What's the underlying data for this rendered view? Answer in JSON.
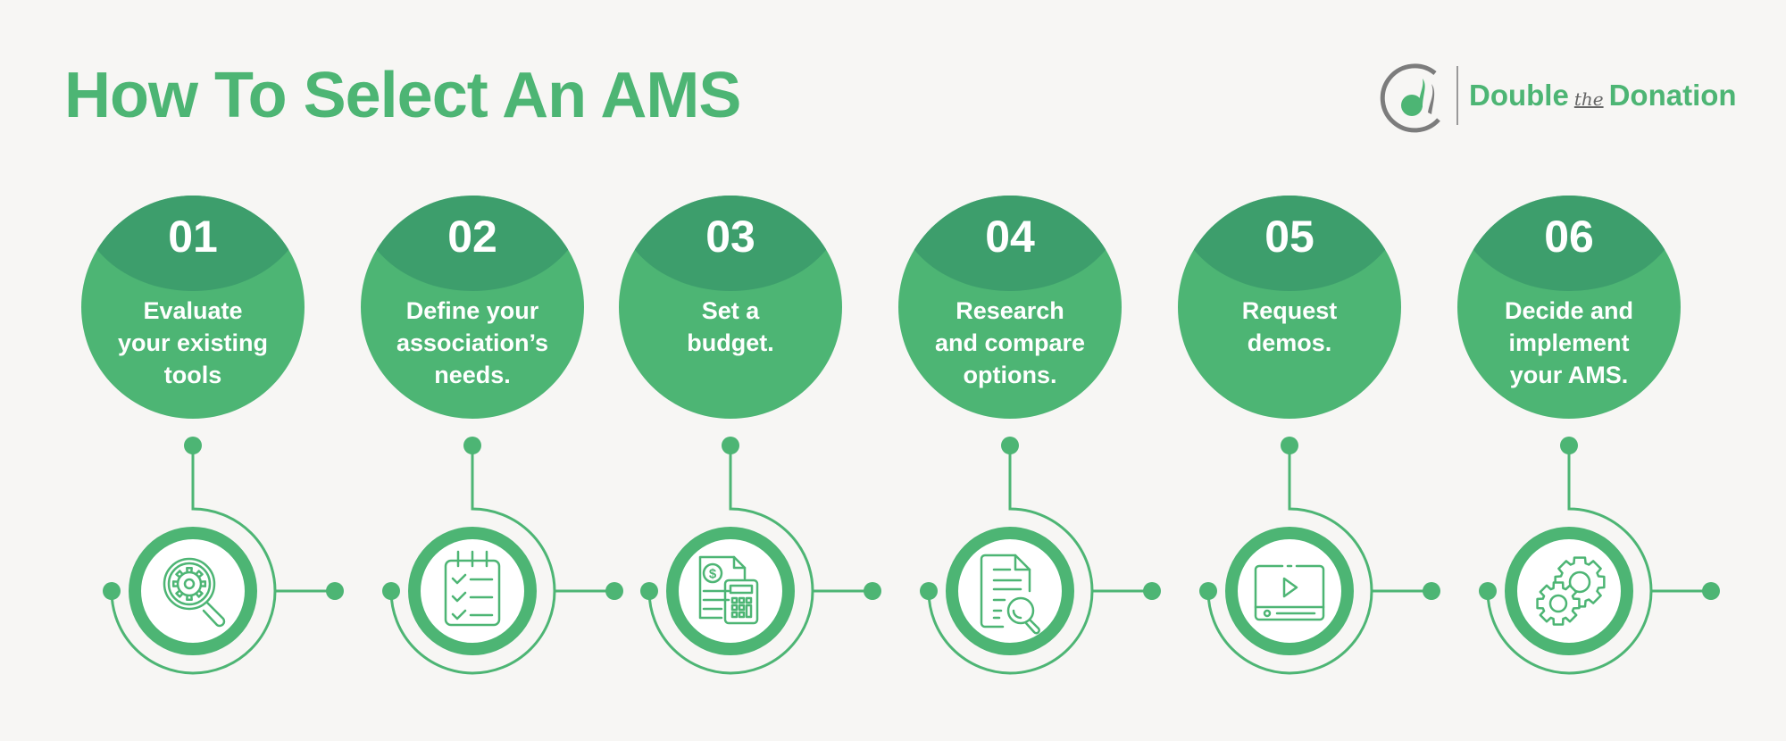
{
  "title": "How To Select An AMS",
  "logo": {
    "word1": "Double",
    "the": "the",
    "word2": "Donation"
  },
  "colors": {
    "primary": "#4db574",
    "dark": "#3d9e6c",
    "background": "#f7f6f4",
    "logo_gray": "#7c7c7c"
  },
  "steps": [
    {
      "number": "01",
      "lines": [
        "Evaluate",
        "your existing",
        "tools"
      ],
      "icon": "magnifier-gear-icon"
    },
    {
      "number": "02",
      "lines": [
        "Define your",
        "association’s",
        "needs."
      ],
      "icon": "checklist-icon"
    },
    {
      "number": "03",
      "lines": [
        "Set a",
        "budget."
      ],
      "icon": "budget-calculator-icon"
    },
    {
      "number": "04",
      "lines": [
        "Research",
        "and compare",
        "options."
      ],
      "icon": "document-search-icon"
    },
    {
      "number": "05",
      "lines": [
        "Request",
        "demos."
      ],
      "icon": "video-demo-icon"
    },
    {
      "number": "06",
      "lines": [
        "Decide and",
        "implement",
        "your AMS."
      ],
      "icon": "gears-icon"
    }
  ]
}
